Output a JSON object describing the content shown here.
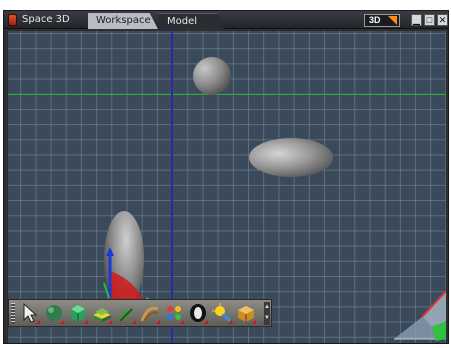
{
  "window": {
    "title": "Space 3D",
    "tabs": [
      {
        "label": "Workspace",
        "active": false
      },
      {
        "label": "Model",
        "active": true
      }
    ],
    "view_mode": "3D",
    "controls": [
      "minimize-icon",
      "maximize-icon",
      "close-icon"
    ]
  },
  "viewport": {
    "background_color": "#3b4a5a",
    "grid_color": "#8caabe",
    "x_axis_color": "#2fae36",
    "y_axis_color": "#2a2aa8",
    "objects": [
      "sphere",
      "horizontal-ellipsoid",
      "vertical-ellipsoid"
    ],
    "gizmo_axes": {
      "x": "#1fbf3a",
      "y": "#1a3ad8",
      "rotation": "#e01a1a"
    }
  },
  "toolbar": {
    "tools": [
      {
        "name": "select-arrow-icon"
      },
      {
        "name": "sphere-tool-icon"
      },
      {
        "name": "cube-tool-icon"
      },
      {
        "name": "terrain-tool-icon"
      },
      {
        "name": "plant-tool-icon"
      },
      {
        "name": "shape-tool-icon"
      },
      {
        "name": "particles-tool-icon"
      },
      {
        "name": "torus-tool-icon"
      },
      {
        "name": "light-tool-icon"
      },
      {
        "name": "box-tool-icon"
      }
    ],
    "indicator_color": "#e01010"
  }
}
